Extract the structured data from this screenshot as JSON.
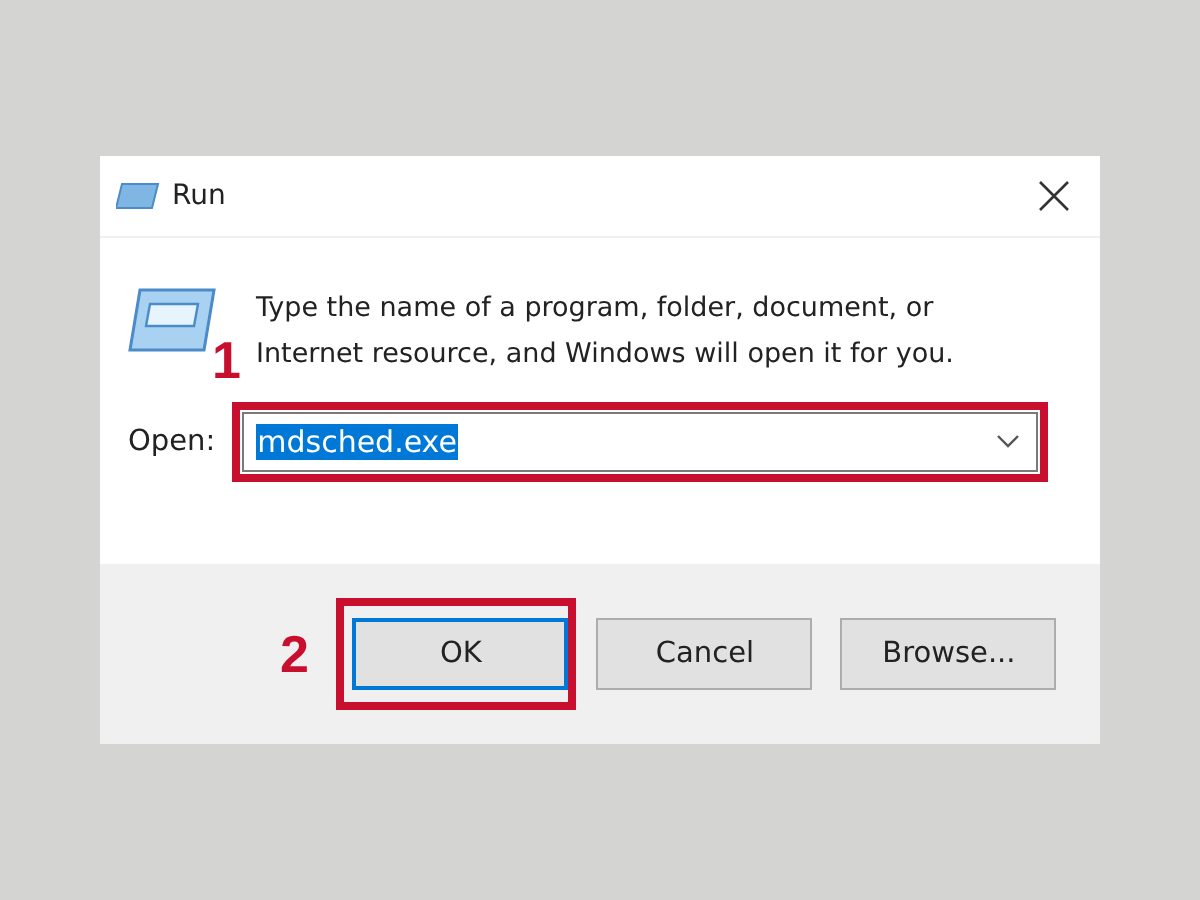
{
  "window": {
    "title": "Run"
  },
  "message": "Type the name of a program, folder, document, or Internet resource, and Windows will open it for you.",
  "open_field": {
    "label": "Open:",
    "value": "mdsched.exe",
    "highlighted": true
  },
  "buttons": [
    {
      "label": "OK",
      "default": true,
      "highlighted": true
    },
    {
      "label": "Cancel",
      "default": false,
      "highlighted": false
    },
    {
      "label": "Browse...",
      "default": false,
      "highlighted": false
    }
  ],
  "step_markers": [
    "1",
    "2"
  ]
}
